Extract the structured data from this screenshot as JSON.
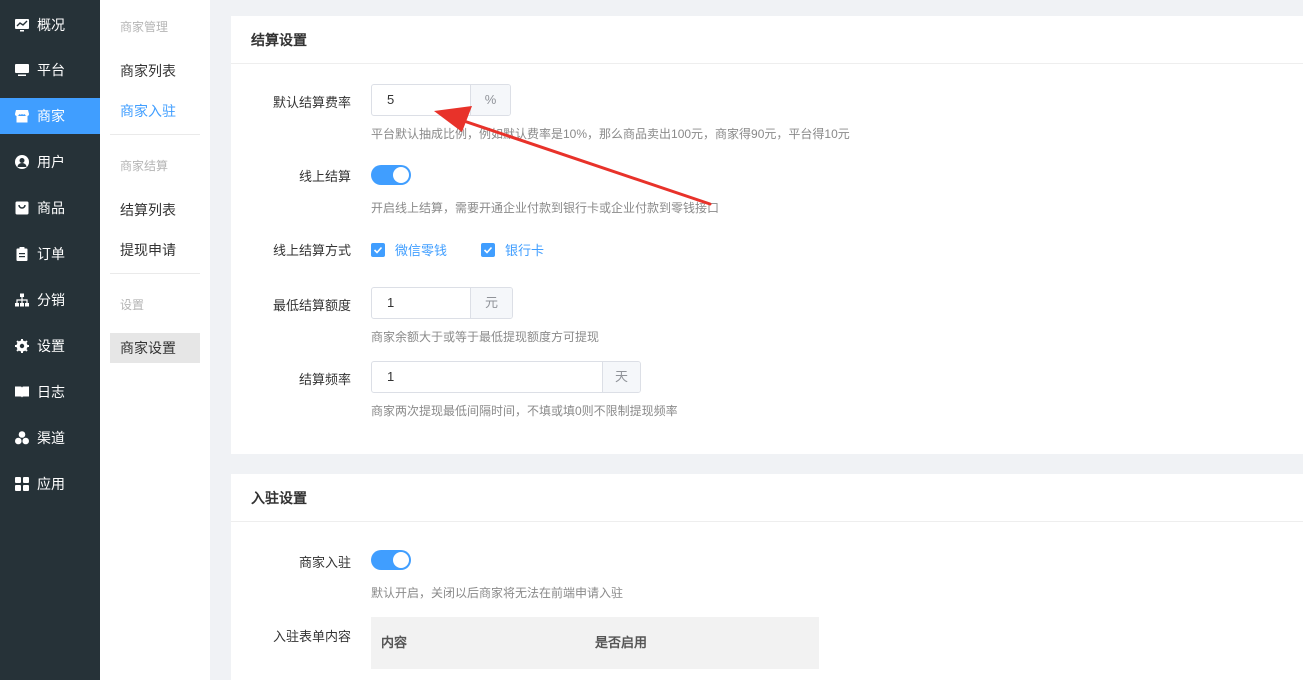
{
  "sidebar": {
    "items": [
      {
        "label": "概况",
        "icon": "dashboard-icon"
      },
      {
        "label": "平台",
        "icon": "monitor-icon"
      },
      {
        "label": "商家",
        "icon": "store-icon"
      },
      {
        "label": "用户",
        "icon": "user-icon"
      },
      {
        "label": "商品",
        "icon": "goods-icon"
      },
      {
        "label": "订单",
        "icon": "clipboard-icon"
      },
      {
        "label": "分销",
        "icon": "sitemap-icon"
      },
      {
        "label": "设置",
        "icon": "gear-icon"
      },
      {
        "label": "日志",
        "icon": "book-icon"
      },
      {
        "label": "渠道",
        "icon": "cubes-icon"
      },
      {
        "label": "应用",
        "icon": "grid-icon"
      }
    ],
    "active_index": 2
  },
  "submenu": {
    "group1": "商家管理",
    "item_list": "商家列表",
    "item_join": "商家入驻",
    "group2": "商家结算",
    "item_settle_list": "结算列表",
    "item_withdraw": "提现申请",
    "group3": "设置",
    "item_settings": "商家设置"
  },
  "settlement": {
    "title": "结算设置",
    "fee_label": "默认结算费率",
    "fee_value": "5",
    "fee_unit": "%",
    "fee_hint": "平台默认抽成比例，例如默认费率是10%，那么商品卖出100元，商家得90元，平台得10元",
    "online_label": "线上结算",
    "online_enabled": true,
    "online_hint": "开启线上结算，需要开通企业付款到银行卡或企业付款到零钱接口",
    "method_label": "线上结算方式",
    "method_wechat": "微信零钱",
    "method_bank": "银行卡",
    "min_label": "最低结算额度",
    "min_value": "1",
    "min_unit": "元",
    "min_hint": "商家余额大于或等于最低提现额度方可提现",
    "freq_label": "结算频率",
    "freq_value": "1",
    "freq_unit": "天",
    "freq_hint": "商家两次提现最低间隔时间，不填或填0则不限制提现频率"
  },
  "join": {
    "title": "入驻设置",
    "join_label": "商家入驻",
    "join_enabled": true,
    "join_hint": "默认开启，关闭以后商家将无法在前端申请入驻",
    "form_label": "入驻表单内容",
    "col_content": "内容",
    "col_enabled": "是否启用"
  },
  "colors": {
    "accent": "#409eff",
    "sidebar_bg": "#263238",
    "annotation_arrow": "#e8322a"
  }
}
